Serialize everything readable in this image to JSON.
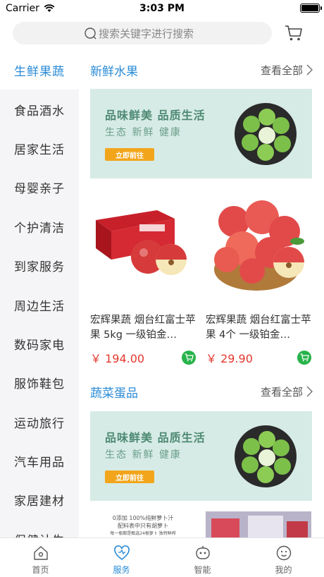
{
  "status_bar": {
    "carrier": "Carrier",
    "time": "3:03 PM"
  },
  "search": {
    "placeholder": "搜索关键字进行搜索"
  },
  "sidebar": {
    "items": [
      {
        "label": "生鲜果蔬",
        "active": true
      },
      {
        "label": "食品酒水"
      },
      {
        "label": "居家生活"
      },
      {
        "label": "母婴亲子"
      },
      {
        "label": "个护清洁"
      },
      {
        "label": "到家服务"
      },
      {
        "label": "周边生活"
      },
      {
        "label": "数码家电"
      },
      {
        "label": "服饰鞋包"
      },
      {
        "label": "运动旅行"
      },
      {
        "label": "汽车用品"
      },
      {
        "label": "家居建材"
      },
      {
        "label": "保健计生"
      }
    ]
  },
  "sections": [
    {
      "title": "新鲜水果",
      "more": "查看全部",
      "banner": {
        "line1": "品味鲜美 品质生活",
        "line2": "生态 新鲜 健康",
        "button": "立即前往"
      },
      "products": [
        {
          "name": "宏辉果蔬 烟台红富士苹果 5kg 一级铂金…",
          "price": "￥ 194.00"
        },
        {
          "name": "宏辉果蔬 烟台红富士苹果 4个 一级铂金…",
          "price": "￥ 29.90"
        }
      ]
    },
    {
      "title": "蔬菜蛋品",
      "more": "查看全部",
      "banner": {
        "line1": "品味鲜美 品质生活",
        "line2": "生态 新鲜 健康",
        "button": "立即前往"
      },
      "strip_text": {
        "line1": "0添加 100%纯鲜萝卜汁",
        "line2": "配料表中只有胡萝卜",
        "line3": "每一瓶都是甄选24根萝卜 独特鲜榨"
      }
    }
  ],
  "tabbar": [
    {
      "label": "首页",
      "icon": "home-icon"
    },
    {
      "label": "服务",
      "icon": "heart-icon",
      "active": true
    },
    {
      "label": "智能",
      "icon": "robot-icon"
    },
    {
      "label": "我的",
      "icon": "face-icon"
    }
  ],
  "colors": {
    "accent": "#2a8bd6",
    "price": "#e3382e",
    "banner_bg": "#d7ebe6",
    "cart_green": "#28b34a",
    "button_orange": "#f2a51b"
  }
}
